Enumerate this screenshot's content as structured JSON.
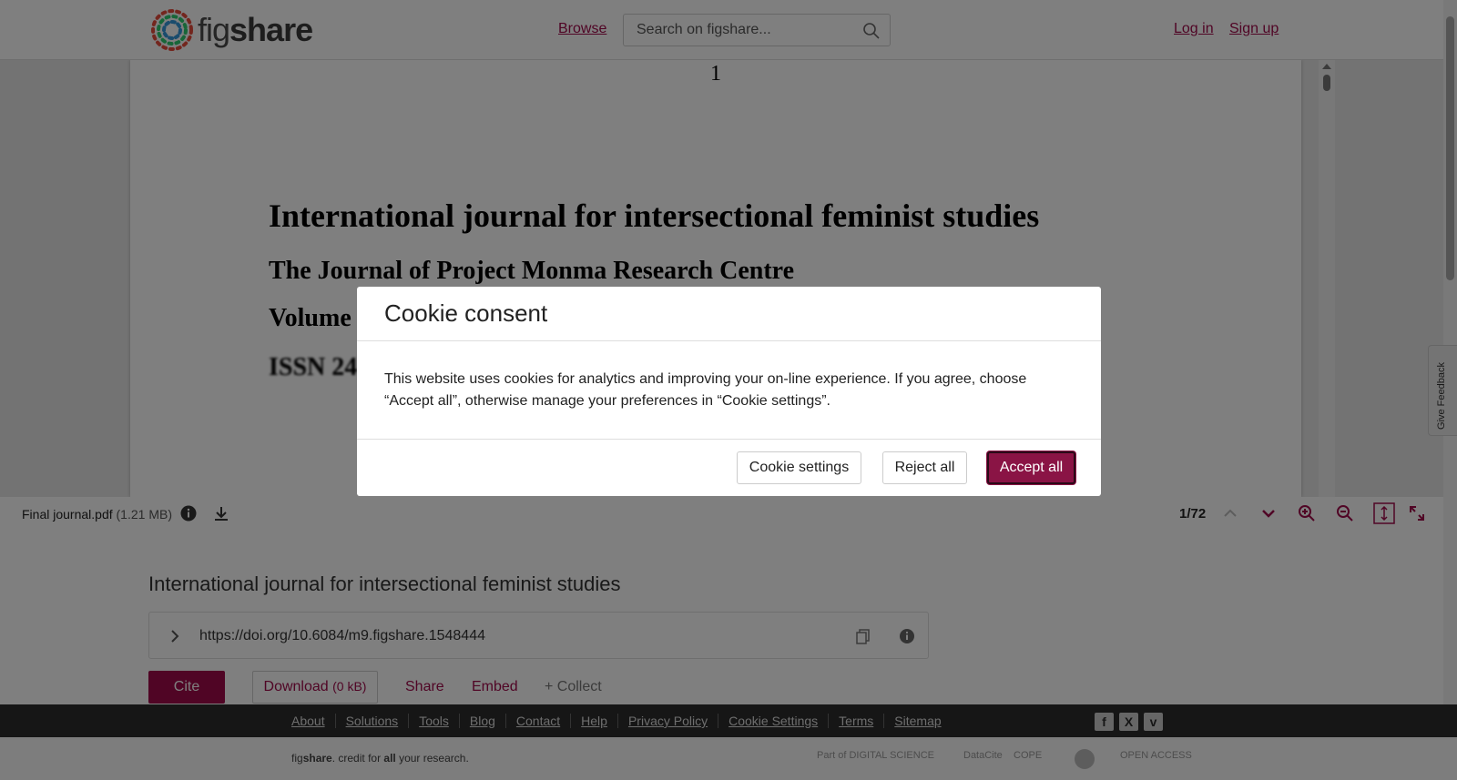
{
  "header": {
    "logo_text_light": "fig",
    "logo_text_bold": "share",
    "browse_label": "Browse",
    "search_placeholder": "Search on figshare...",
    "login_label": "Log in",
    "signup_label": "Sign up"
  },
  "viewer": {
    "page_number": "1",
    "pdf_title": "International journal for intersectional feminist studies",
    "pdf_subtitle": "The Journal of Project Monma Research Centre",
    "pdf_volume": "Volume",
    "pdf_issn": "ISSN 24"
  },
  "toolbar": {
    "file_name": "Final journal.pdf",
    "file_size": "(1.21 MB)",
    "page_count": "1/72"
  },
  "item": {
    "title": "International journal for intersectional feminist studies",
    "doi": "https://doi.org/10.6084/m9.figshare.1548444",
    "cite_label": "Cite",
    "download_label": "Download",
    "download_size": "(0 kB)",
    "share_label": "Share",
    "embed_label": "Embed",
    "collect_label": "+ Collect"
  },
  "footer": {
    "links": [
      "About",
      "Solutions",
      "Tools",
      "Blog",
      "Contact",
      "Help",
      "Privacy Policy",
      "Cookie Settings",
      "Terms",
      "Sitemap"
    ],
    "credit_fig": "fig",
    "credit_share": "share",
    "credit_mid": ". credit for ",
    "credit_all": "all",
    "credit_end": " your research.",
    "partner_digital_science": "Part of DIGITAL SCIENCE",
    "partner_datacite": "DataCite",
    "partner_cope": "COPE",
    "partner_open_access": "OPEN ACCESS"
  },
  "feedback_label": "Give Feedback",
  "modal": {
    "title": "Cookie consent",
    "body": "This website uses cookies for analytics and improving your on-line experience. If you agree, choose “Accept all”, otherwise manage your preferences in “Cookie settings”.",
    "settings_label": "Cookie settings",
    "reject_label": "Reject all",
    "accept_label": "Accept all"
  },
  "colors": {
    "brand": "#a00b4b",
    "accept_button": "#8a1445",
    "footer_bg": "#2d2d2d"
  }
}
